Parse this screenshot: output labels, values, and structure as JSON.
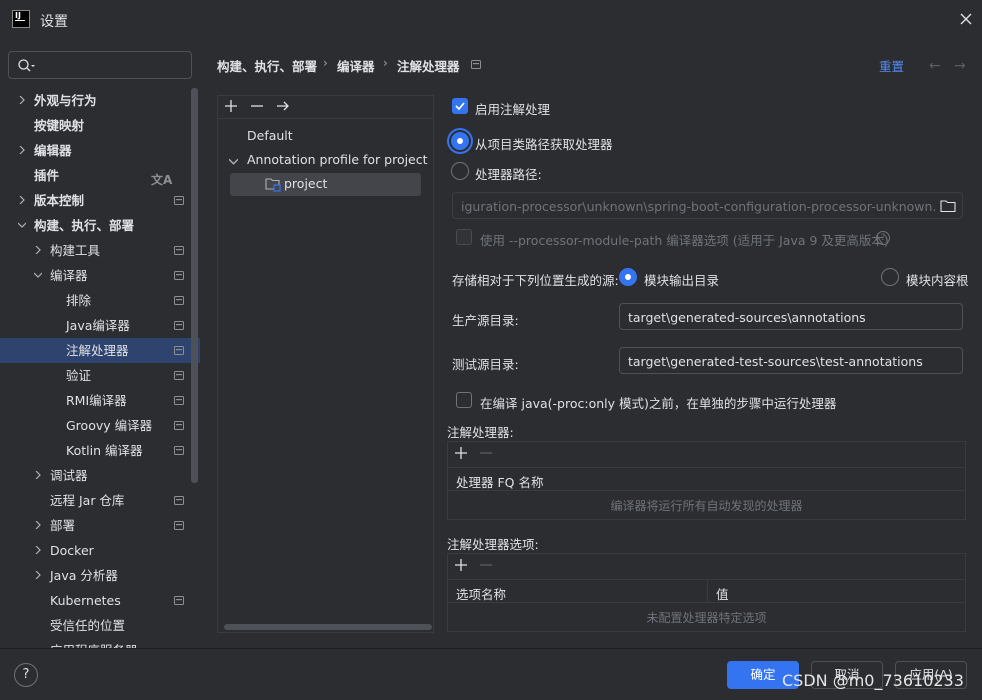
{
  "window": {
    "title": "设置",
    "logo_text": "IJ"
  },
  "search": {
    "placeholder": "",
    "value": ""
  },
  "sidebar": {
    "items": [
      {
        "label": "外观与行为"
      },
      {
        "label": "按键映射"
      },
      {
        "label": "编辑器"
      },
      {
        "label": "插件"
      },
      {
        "label": "版本控制"
      },
      {
        "label": "构建、执行、部署"
      },
      {
        "label": "构建工具"
      },
      {
        "label": "编译器"
      },
      {
        "label": "排除"
      },
      {
        "label": "Java编译器"
      },
      {
        "label": "注解处理器"
      },
      {
        "label": "验证"
      },
      {
        "label": "RMI编译器"
      },
      {
        "label": "Groovy 编译器"
      },
      {
        "label": "Kotlin 编译器"
      },
      {
        "label": "调试器"
      },
      {
        "label": "远程 Jar 仓库"
      },
      {
        "label": "部署"
      },
      {
        "label": "Docker"
      },
      {
        "label": "Java 分析器"
      },
      {
        "label": "Kubernetes"
      },
      {
        "label": "受信任的位置"
      },
      {
        "label": "应用程序服务器"
      }
    ]
  },
  "breadcrumb": {
    "part1": "构建、执行、部署",
    "part2": "编译器",
    "part3": "注解处理器",
    "sep": "›"
  },
  "header": {
    "reset_label": "重置",
    "back": "←",
    "forward": "→"
  },
  "profiles": {
    "default_label": "Default",
    "profile_label": "Annotation profile for project",
    "module_label": "project"
  },
  "form": {
    "enable_label": "启用注解处理",
    "from_classpath_label": "从项目类路径获取处理器",
    "processor_path_label": "处理器路径:",
    "processor_path_value": "iguration-processor\\unknown\\spring-boot-configuration-processor-unknown.jar",
    "module_path_label": "使用 --processor-module-path 编译器选项 (适用于 Java 9 及更高版本)",
    "store_label": "存储相对于下列位置生成的源:",
    "module_output_label": "模块输出目录",
    "module_content_label": "模块内容根",
    "prod_dir_label": "生产源目录:",
    "prod_dir_value": "target\\generated-sources\\annotations",
    "test_dir_label": "测试源目录:",
    "test_dir_value": "target\\generated-test-sources\\test-annotations",
    "separate_step_label": "在编译 java(-proc:only 模式)之前，在单独的步骤中运行处理器"
  },
  "processors_table": {
    "title": "注解处理器:",
    "column": "处理器 FQ 名称",
    "empty_text": "编译器将运行所有自动发现的处理器"
  },
  "options_table": {
    "title": "注解处理器选项:",
    "col_name": "选项名称",
    "col_value": "值",
    "empty_text": "未配置处理器特定选项"
  },
  "footer": {
    "help": "?",
    "ok_label": "确定",
    "cancel_label": "取消",
    "apply_label": "应用(A)",
    "watermark": "CSDN @m0_73610233"
  },
  "colors": {
    "accent": "#3574f0",
    "link": "#548af7",
    "selection": "#2e436e",
    "background": "#2b2d30"
  }
}
